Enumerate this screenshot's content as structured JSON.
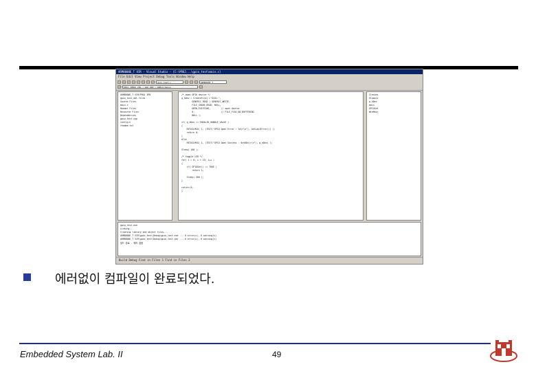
{
  "ide": {
    "title": "ARM8800E_T VIR - Visual Studio - [C:\\PROJ...\\gpio_test\\main.c]",
    "menu": "File  Edit  View  Project  Debug  Tools  Window  Help",
    "config_field": "PROJ 3PBOO VIR | GAP RAM | ARMv4 Debug",
    "function_field": "gpio_test.c",
    "project_field": "ARM8800E_T",
    "tree_items": [
      "ARM8800E_T VIR/PROJ 3PB",
      "gpio_test_ddl files",
      "Source Files",
      "main.c",
      "Header Files",
      "Resource Files",
      "Dependencies",
      "gpio_test.cpp",
      "config.h",
      "readme.txt"
    ],
    "code_lines": [
      "/* open GPIO device */",
      "g_hDev = CreateFile( L\"GIO1:\",",
      "        GENERIC_READ | GENERIC_WRITE,",
      "        FILE_SHARE_READ, NULL,",
      "        OPEN_EXISTING,        // open device",
      "        0,                    // FILE_FLAG_NO_BUFFERING",
      "        NULL );",
      "",
      "if( g_hDev == INVALID_HANDLE_VALUE )",
      "{",
      "    RETAILMSG( 1, (TEXT(\"GPIO Open Error : %d\\r\\n\"), GetLastError()) );",
      "    return 0;",
      "}",
      "else",
      "    RETAILMSG( 1, (TEXT(\"GPIO Open Success : 0x%08x\\r\\n\"), g_hDev) );",
      "",
      "Sleep( 100 );",
      "",
      "/* toggle LED */",
      "for( i = 0; i < 10; i++ )",
      "{",
      "    if( GPIOSet() == TRUE )",
      "        return 1;",
      "",
      "    Sleep( 500 );",
      "}",
      "",
      "return 0;",
      "}"
    ],
    "class_tree": [
      "Classes",
      "Globals",
      "g_hDev",
      "main",
      "GPIOSet",
      "WinMain"
    ],
    "output_lines": [
      "gpio_test.exe",
      "Linking...",
      "Creating library and object files...",
      "ARM8800E_T VIR\\gpio_test\\Debug\\gpio_test.exe ... 0 error(s), 0 warning(s)",
      "ARM8800E_T VIR\\gpio_test\\Debug\\gpio_test.obj ... 0 error(s), 0 warning(s)",
      "빌드 완료 - 에러 없음"
    ],
    "status_tabs": "Build  Debug  Find in Files 1  Find in Files 2"
  },
  "caption": "에러없이 컴파일이 완료되었다.",
  "footer": "Embedded System Lab. II",
  "page_number": "49",
  "colors": {
    "accent": "#2a3a9a",
    "title_bar": "#0a246a",
    "logo": "#c0392b"
  }
}
